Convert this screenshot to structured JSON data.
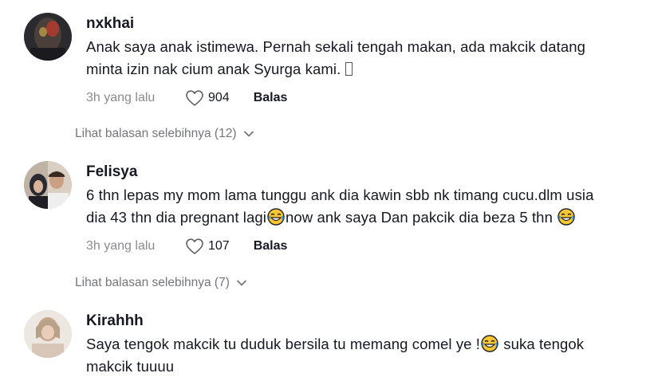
{
  "comments": [
    {
      "username": "nxkhai",
      "text_line1": "Anak saya anak istimewa. Pernah sekali tengah makan, ada makcik datang",
      "text_line2": "minta izin nak cium anak Syurga kami.",
      "time": "3h yang lalu",
      "likes": "904",
      "reply_label": "Balas",
      "more_replies": "Lihat balasan selebihnya (12)"
    },
    {
      "username": "Felisya",
      "text_line1": "6 thn lepas my mom lama tunggu ank dia kawin sbb nk timang cucu.dlm usia",
      "text_line2a": "dia 43 thn dia pregnant lagi",
      "text_line2b": "now ank saya Dan pakcik dia beza 5 thn ",
      "time": "3h yang lalu",
      "likes": "107",
      "reply_label": "Balas",
      "more_replies": "Lihat balasan selebihnya (7)"
    },
    {
      "username": "Kirahhh",
      "text_line1a": "Saya tengok makcik tu duduk bersila tu memang comel ye !",
      "text_line1b": " suka tengok",
      "text_line2": "makcik tuuuu"
    }
  ],
  "icons": {
    "heart": "heart-outline-icon",
    "chevron": "chevron-down-icon",
    "emoji": "tears-of-joy-emoji"
  },
  "colors": {
    "text": "#161823",
    "secondary": "#8a8b91",
    "emoji_face": "#f7c634"
  }
}
